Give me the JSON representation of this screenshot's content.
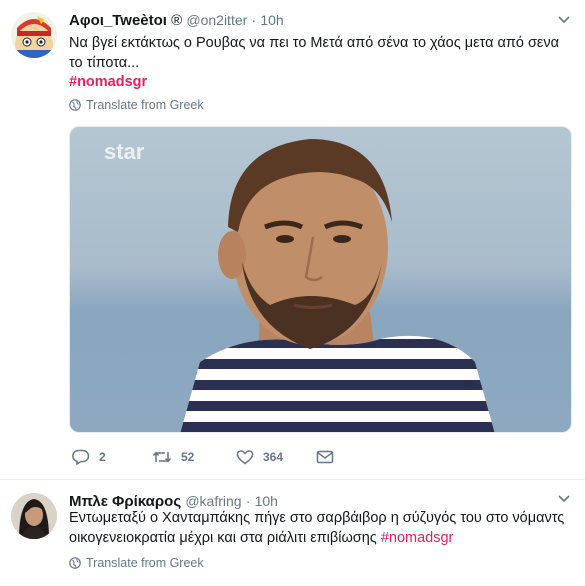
{
  "tweets": [
    {
      "name": "Αφοι_Tweètoι",
      "name_badge": "®",
      "handle": "@on2itter",
      "separator": "·",
      "time": "10h",
      "text": "Να βγεί εκτάκτως ο Ρουβας να πει το Μετά από σένα το χάος μετα από σενα το τίποτα...",
      "hashtag": "#nomadsgr",
      "translate_label": "Translate from Greek",
      "media_watermark": "star",
      "actions": {
        "replies": "2",
        "retweets": "52",
        "likes": "364"
      }
    },
    {
      "name": "Μπλε Φρίκαρος",
      "handle": "@kafring",
      "separator": "·",
      "time": "10h",
      "text": "Εντωμεταξύ ο Χανταμπάκης πήγε στο σαρβάιβορ η σύζυγός του στο νόμαντς οικογενειοκρατία μέχρι και στα ριάλιτι επιβίωσης",
      "hashtag": "#nomadsgr",
      "translate_label": "Translate from Greek"
    }
  ],
  "colors": {
    "hashtag": "#e0245e",
    "secondary_text": "#657786",
    "divider": "#e6ecf0"
  }
}
